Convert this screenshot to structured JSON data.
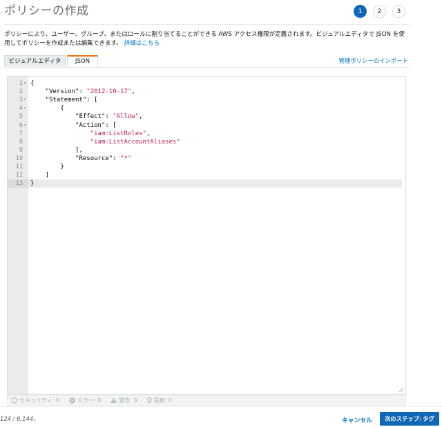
{
  "header": {
    "title": "ポリシーの作成",
    "steps": [
      "1",
      "2",
      "3"
    ],
    "active_step": 1
  },
  "description": {
    "text": "ポリシーにより、ユーザー、グループ、またはロールに割り当てることができる AWS アクセス権限が定義されます。ビジュアルエディタで JSON を使用してポリシーを作成または編集できます。",
    "link": "詳細はこちら"
  },
  "tabs": [
    {
      "label": "ビジュアルエディタ",
      "active": false
    },
    {
      "label": "JSON",
      "active": true
    }
  ],
  "import_link": "管理ポリシーのインポート",
  "editor": {
    "active_line": 13,
    "lines": [
      {
        "n": "1",
        "fold": true,
        "code": "{"
      },
      {
        "n": "2",
        "fold": false,
        "code": "    \"Version\": \"2012-10-17\","
      },
      {
        "n": "3",
        "fold": true,
        "code": "    \"Statement\": ["
      },
      {
        "n": "4",
        "fold": true,
        "code": "        {"
      },
      {
        "n": "5",
        "fold": false,
        "code": "            \"Effect\": \"Allow\","
      },
      {
        "n": "6",
        "fold": true,
        "code": "            \"Action\": ["
      },
      {
        "n": "7",
        "fold": false,
        "code": "                \"iam:ListRoles\","
      },
      {
        "n": "8",
        "fold": false,
        "code": "                \"iam:ListAccountAliases\""
      },
      {
        "n": "9",
        "fold": false,
        "code": "            ],"
      },
      {
        "n": "10",
        "fold": false,
        "code": "            \"Resource\": \"*\""
      },
      {
        "n": "11",
        "fold": false,
        "code": "        }"
      },
      {
        "n": "12",
        "fold": false,
        "code": "    ]"
      },
      {
        "n": "13",
        "fold": false,
        "code": "}"
      }
    ]
  },
  "status_bar": {
    "security": "セキュリティ: 0",
    "errors": "エラー: 0",
    "warnings": "警告: 0",
    "suggestions": "提案: 0"
  },
  "footer": {
    "char_count": "124 / 6,144。",
    "cancel_label": "キャンセル",
    "next_label": "次のステップ: タグ"
  },
  "colors": {
    "primary": "#0f67b6",
    "link": "#0073bb",
    "tab_accent": "#ec7211",
    "string": "#c41a5b"
  }
}
